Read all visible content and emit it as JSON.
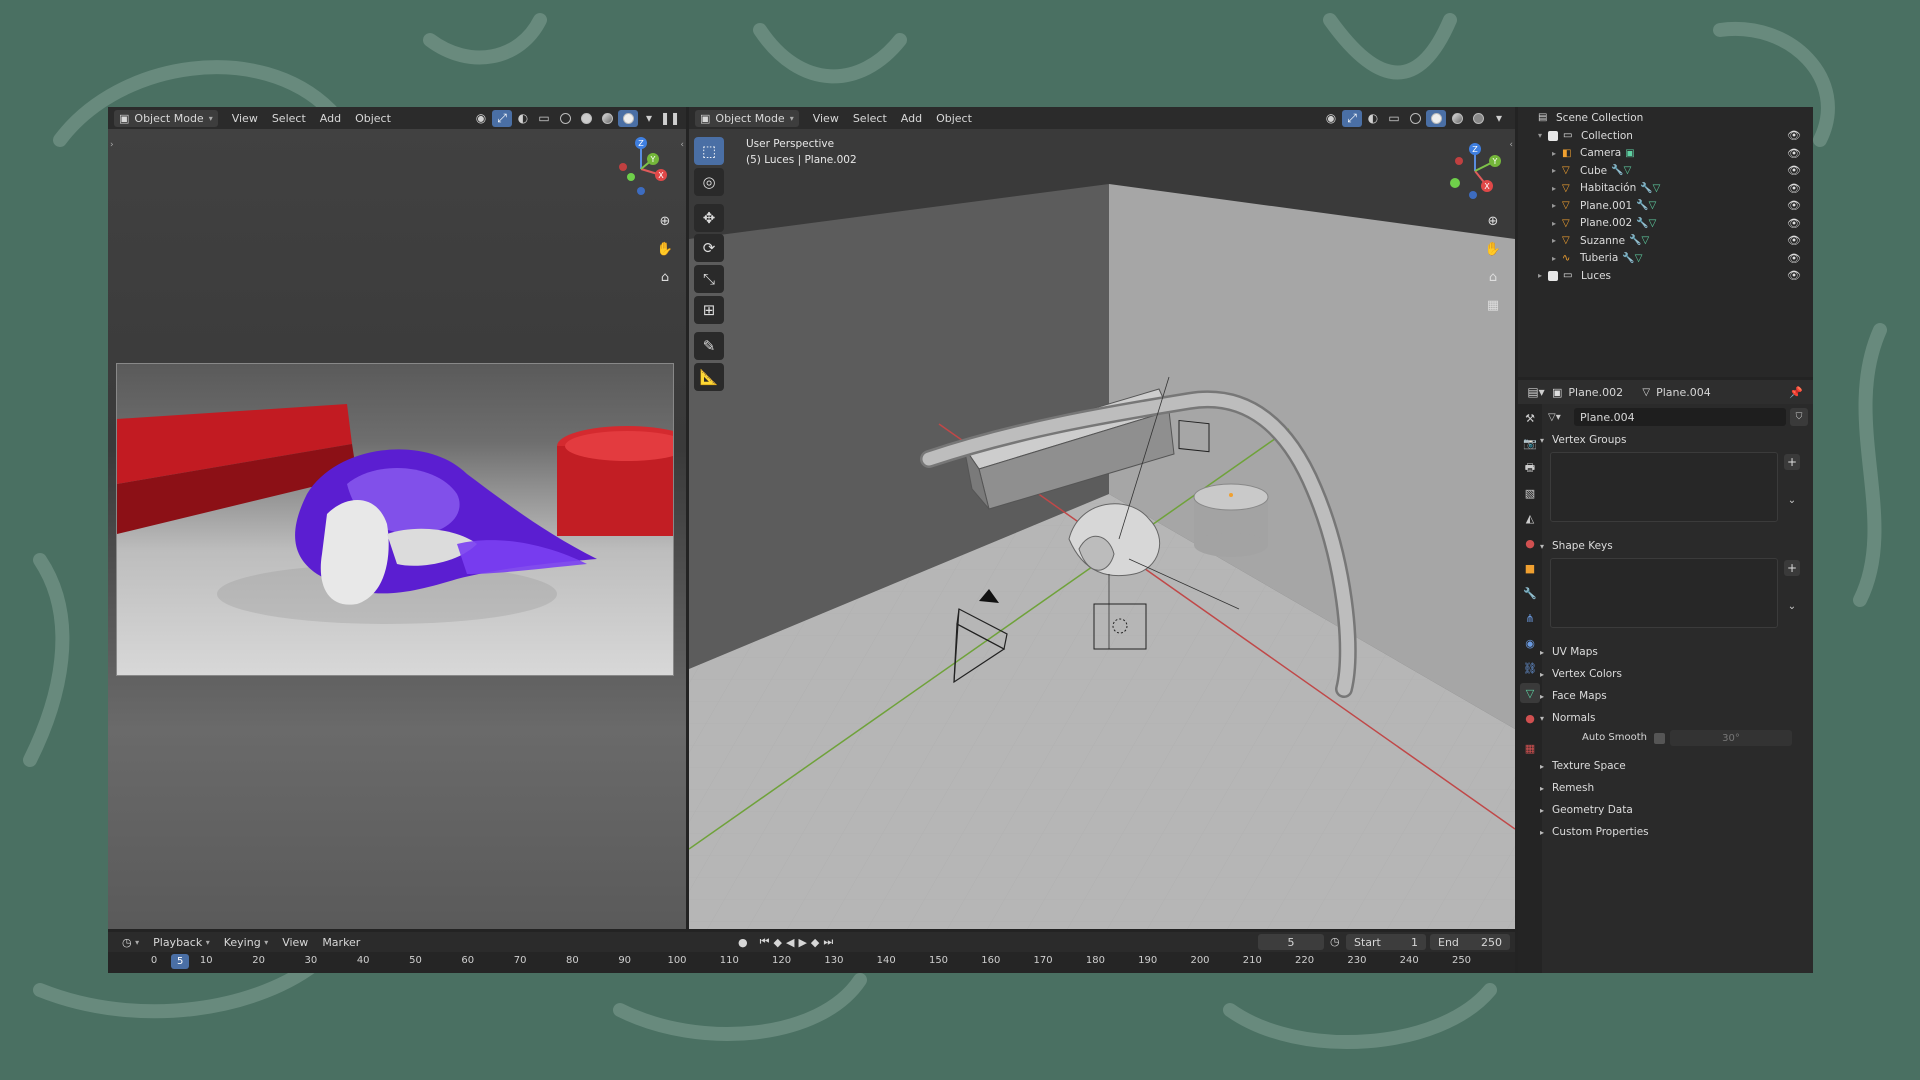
{
  "left_viewport": {
    "mode": "Object Mode",
    "menu": [
      "View",
      "Select",
      "Add",
      "Object"
    ]
  },
  "main_viewport": {
    "mode": "Object Mode",
    "menu": [
      "View",
      "Select",
      "Add",
      "Object"
    ],
    "overlay_line1": "User Perspective",
    "overlay_line2": "(5) Luces | Plane.002"
  },
  "gizmo": {
    "x": "X",
    "y": "Y",
    "z": "Z"
  },
  "outliner": {
    "root": "Scene Collection",
    "items": [
      {
        "label": "Collection",
        "icon": "collection-icon",
        "indent": 1,
        "expanded": true
      },
      {
        "label": "Camera",
        "icon": "camera-icon",
        "indent": 2
      },
      {
        "label": "Cube",
        "icon": "mesh-icon",
        "indent": 2
      },
      {
        "label": "Habitación",
        "icon": "mesh-icon",
        "indent": 2
      },
      {
        "label": "Plane.001",
        "icon": "mesh-icon",
        "indent": 2
      },
      {
        "label": "Plane.002",
        "icon": "mesh-icon",
        "indent": 2
      },
      {
        "label": "Suzanne",
        "icon": "mesh-icon",
        "indent": 2
      },
      {
        "label": "Tuberia",
        "icon": "curve-icon",
        "indent": 2
      },
      {
        "label": "Luces",
        "icon": "collection-icon",
        "indent": 1,
        "expanded": false
      }
    ]
  },
  "properties": {
    "object_name": "Plane.002",
    "data_name": "Plane.004",
    "mesh_field": "Plane.004",
    "panels": [
      {
        "label": "Vertex Groups",
        "open": true
      },
      {
        "label": "Shape Keys",
        "open": true
      },
      {
        "label": "UV Maps",
        "open": false
      },
      {
        "label": "Vertex Colors",
        "open": false
      },
      {
        "label": "Face Maps",
        "open": false
      },
      {
        "label": "Normals",
        "open": true
      },
      {
        "label": "Texture Space",
        "open": false
      },
      {
        "label": "Remesh",
        "open": false
      },
      {
        "label": "Geometry Data",
        "open": false
      },
      {
        "label": "Custom Properties",
        "open": false
      }
    ],
    "auto_smooth_label": "Auto Smooth",
    "auto_smooth_angle": "30°"
  },
  "timeline": {
    "menu": [
      "Playback",
      "Keying",
      "View",
      "Marker"
    ],
    "current_frame": "5",
    "start_label": "Start",
    "start_value": "1",
    "end_label": "End",
    "end_value": "250",
    "ticks": [
      "0",
      "10",
      "20",
      "30",
      "40",
      "50",
      "60",
      "70",
      "80",
      "90",
      "100",
      "110",
      "120",
      "130",
      "140",
      "150",
      "160",
      "170",
      "180",
      "190",
      "200",
      "210",
      "220",
      "230",
      "240",
      "250"
    ],
    "playhead": "5"
  }
}
